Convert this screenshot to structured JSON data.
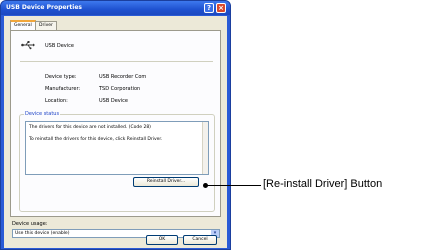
{
  "window": {
    "title": "USB Device Properties",
    "help_glyph": "?",
    "close_glyph": "×"
  },
  "tabs": [
    {
      "label": "General",
      "active": true
    },
    {
      "label": "Driver",
      "active": false
    }
  ],
  "device": {
    "icon": "usb-icon",
    "name": "USB Device"
  },
  "properties": [
    {
      "label": "Device type:",
      "value": "USB Recorder Com"
    },
    {
      "label": "Manufacturer:",
      "value": "TSD Corporation"
    },
    {
      "label": "Location:",
      "value": "USB Device"
    }
  ],
  "device_status": {
    "label": "Device status",
    "lines": [
      "The drivers for this device are not installed. (Code 28)",
      "To reinstall the drivers for this device, click Reinstall Driver."
    ],
    "reinstall_label": "Reinstall Driver..."
  },
  "device_usage": {
    "label": "Device usage:",
    "value": "Use this device (enable)",
    "arrow": "▾"
  },
  "footer": {
    "ok_label": "OK",
    "cancel_label": "Cancel"
  },
  "annotation": {
    "text": "[Re-install Driver] Button"
  },
  "colors": {
    "title_bar": "#2a5bd6",
    "dialog_bg": "#ece9d8",
    "group_label": "#1f44c7"
  }
}
